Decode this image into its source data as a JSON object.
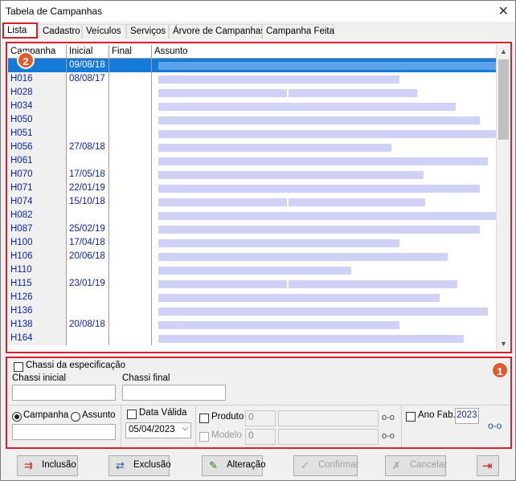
{
  "window": {
    "title": "Tabela de Campanhas",
    "close": "✕"
  },
  "tabs": [
    {
      "label": "Lista"
    },
    {
      "label": "Cadastro"
    },
    {
      "label": "Veículos"
    },
    {
      "label": "Serviços"
    },
    {
      "label": "Árvore de Campanhas"
    },
    {
      "label": "Campanha Feita"
    }
  ],
  "grid": {
    "columns": [
      "Campanha",
      "Inicial",
      "Final",
      "Assunto"
    ],
    "rows": [
      {
        "campanha": "",
        "inicial": "09/08/18",
        "final": ""
      },
      {
        "campanha": "H016",
        "inicial": "08/08/17",
        "final": ""
      },
      {
        "campanha": "H028",
        "inicial": "",
        "final": ""
      },
      {
        "campanha": "H034",
        "inicial": "",
        "final": ""
      },
      {
        "campanha": "H050",
        "inicial": "",
        "final": ""
      },
      {
        "campanha": "H051",
        "inicial": "",
        "final": ""
      },
      {
        "campanha": "H056",
        "inicial": "27/08/18",
        "final": ""
      },
      {
        "campanha": "H061",
        "inicial": "",
        "final": ""
      },
      {
        "campanha": "H070",
        "inicial": "17/05/18",
        "final": ""
      },
      {
        "campanha": "H071",
        "inicial": "22/01/19",
        "final": ""
      },
      {
        "campanha": "H074",
        "inicial": "15/10/18",
        "final": ""
      },
      {
        "campanha": "H082",
        "inicial": "",
        "final": ""
      },
      {
        "campanha": "H087",
        "inicial": "25/02/19",
        "final": ""
      },
      {
        "campanha": "H100",
        "inicial": "17/04/18",
        "final": ""
      },
      {
        "campanha": "H106",
        "inicial": "20/06/18",
        "final": ""
      },
      {
        "campanha": "H110",
        "inicial": "",
        "final": ""
      },
      {
        "campanha": "H115",
        "inicial": "23/01/19",
        "final": ""
      },
      {
        "campanha": "H126",
        "inicial": "",
        "final": ""
      },
      {
        "campanha": "H136",
        "inicial": "",
        "final": ""
      },
      {
        "campanha": "H138",
        "inicial": "20/08/18",
        "final": ""
      },
      {
        "campanha": "H164",
        "inicial": "",
        "final": ""
      }
    ]
  },
  "badges": {
    "list_badge": "2",
    "filter_badge": "1"
  },
  "filters": {
    "chassi_check_label": "Chassi da especificação",
    "chassi_inicial_label": "Chassi inicial",
    "chassi_final_label": "Chassi final",
    "chassi_inicial_value": "",
    "chassi_final_value": "",
    "radio_campanha": "Campanha",
    "radio_assunto": "Assunto",
    "search_value": "",
    "data_valida_label": "Data Válida",
    "data_valida_value": "05/04/2023",
    "produto_label": "Produto",
    "produto_code": "0",
    "modelo_label": "Modelo",
    "modelo_code": "0",
    "ano_fab_label": "Ano Fab.",
    "ano_fab_value": "2023"
  },
  "buttons": {
    "inclusao": "Inclusão",
    "exclusao": "Exclusão",
    "alteracao": "Alteração",
    "confirmar": "Confirmar",
    "cancelar": "Cancelar"
  },
  "colors": {
    "accent_red": "#d6212b",
    "selection_blue": "#1579d8",
    "link_blue": "#0a1ea8",
    "badge_orange": "#e25a2f"
  }
}
